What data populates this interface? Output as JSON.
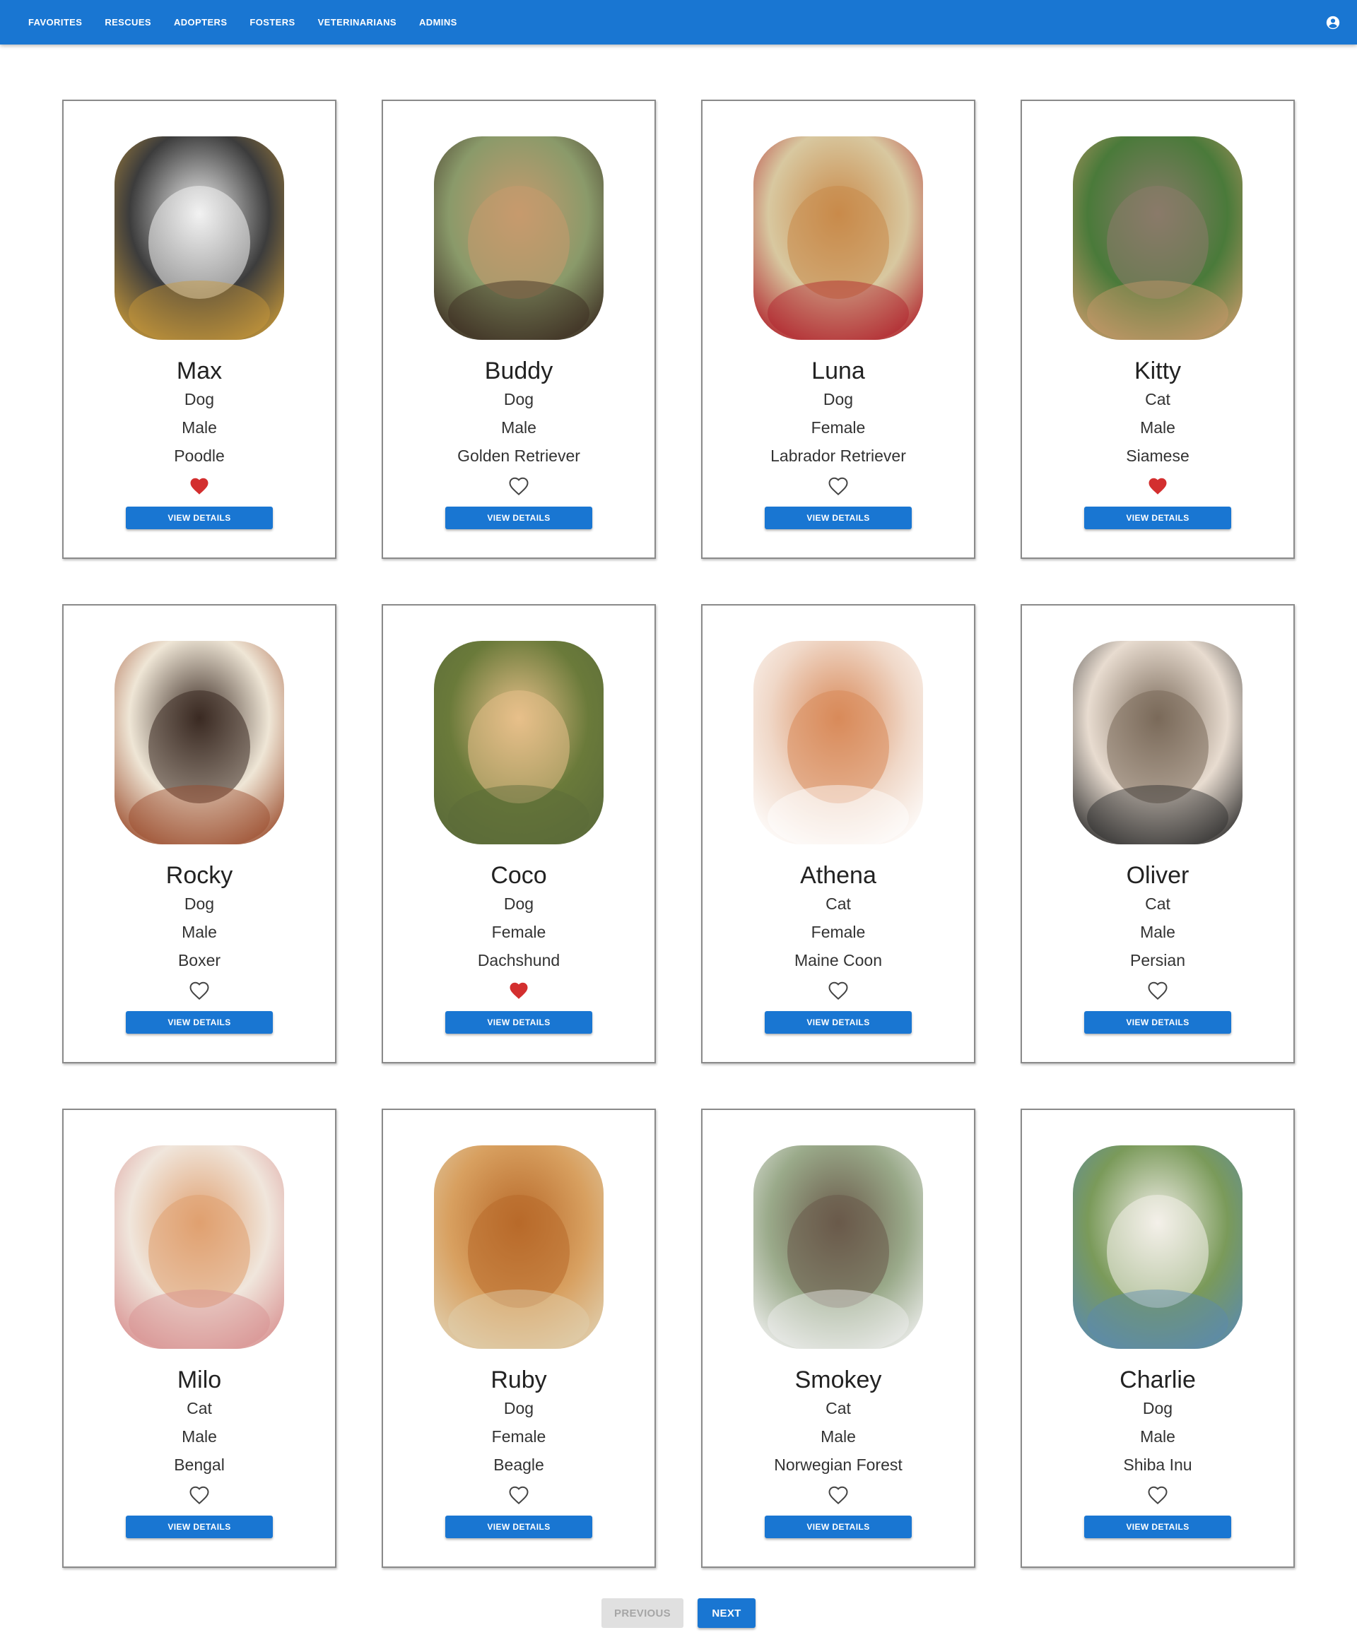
{
  "nav": {
    "links": [
      "FAVORITES",
      "RESCUES",
      "ADOPTERS",
      "FOSTERS",
      "VETERINARIANS",
      "ADMINS"
    ],
    "account_icon": "account-circle-icon"
  },
  "pets": [
    {
      "name": "Max",
      "species": "Dog",
      "gender": "Male",
      "breed": "Poodle",
      "favorite": true,
      "photo_colors": [
        "#3c3c3c",
        "#f2f2f2",
        "#c99a3a"
      ]
    },
    {
      "name": "Buddy",
      "species": "Dog",
      "gender": "Male",
      "breed": "Golden Retriever",
      "favorite": false,
      "photo_colors": [
        "#8a9a6a",
        "#c79a6e",
        "#3a2a20"
      ]
    },
    {
      "name": "Luna",
      "species": "Dog",
      "gender": "Female",
      "breed": "Labrador Retriever",
      "favorite": false,
      "photo_colors": [
        "#d8c8a0",
        "#c98a4a",
        "#b0202a"
      ]
    },
    {
      "name": "Kitty",
      "species": "Cat",
      "gender": "Male",
      "breed": "Siamese",
      "favorite": true,
      "photo_colors": [
        "#4a7a3a",
        "#8a7a6a",
        "#c99a6a"
      ]
    },
    {
      "name": "Rocky",
      "species": "Dog",
      "gender": "Male",
      "breed": "Boxer",
      "favorite": false,
      "photo_colors": [
        "#efe6d6",
        "#3a2a22",
        "#9a4a2a"
      ]
    },
    {
      "name": "Coco",
      "species": "Dog",
      "gender": "Female",
      "breed": "Dachshund",
      "favorite": true,
      "photo_colors": [
        "#6a7a3a",
        "#e8c08a",
        "#5a6a3a"
      ]
    },
    {
      "name": "Athena",
      "species": "Cat",
      "gender": "Female",
      "breed": "Maine Coon",
      "favorite": false,
      "photo_colors": [
        "#f0d8c8",
        "#d88a5a",
        "#ffffff"
      ]
    },
    {
      "name": "Oliver",
      "species": "Cat",
      "gender": "Male",
      "breed": "Persian",
      "favorite": false,
      "photo_colors": [
        "#e8dcd0",
        "#7a6a5a",
        "#2a2a2a"
      ]
    },
    {
      "name": "Milo",
      "species": "Cat",
      "gender": "Male",
      "breed": "Bengal",
      "favorite": false,
      "photo_colors": [
        "#f0e6dc",
        "#e0a070",
        "#d89090"
      ]
    },
    {
      "name": "Ruby",
      "species": "Dog",
      "gender": "Female",
      "breed": "Beagle",
      "favorite": false,
      "photo_colors": [
        "#d8a060",
        "#b86a2a",
        "#e0d0b0"
      ]
    },
    {
      "name": "Smokey",
      "species": "Cat",
      "gender": "Male",
      "breed": "Norwegian Forest",
      "favorite": false,
      "photo_colors": [
        "#9aaa8a",
        "#6a5a4a",
        "#f0f0f0"
      ]
    },
    {
      "name": "Charlie",
      "species": "Dog",
      "gender": "Male",
      "breed": "Shiba Inu",
      "favorite": false,
      "photo_colors": [
        "#7a9a5a",
        "#f4f0ea",
        "#5a8ab0"
      ]
    }
  ],
  "card": {
    "details_label": "VIEW DETAILS"
  },
  "pagination": {
    "previous_label": "PREVIOUS",
    "next_label": "NEXT",
    "previous_disabled": true
  },
  "colors": {
    "primary": "#1976d2",
    "favorite": "#d32f2f",
    "outline_heart": "#444444"
  }
}
